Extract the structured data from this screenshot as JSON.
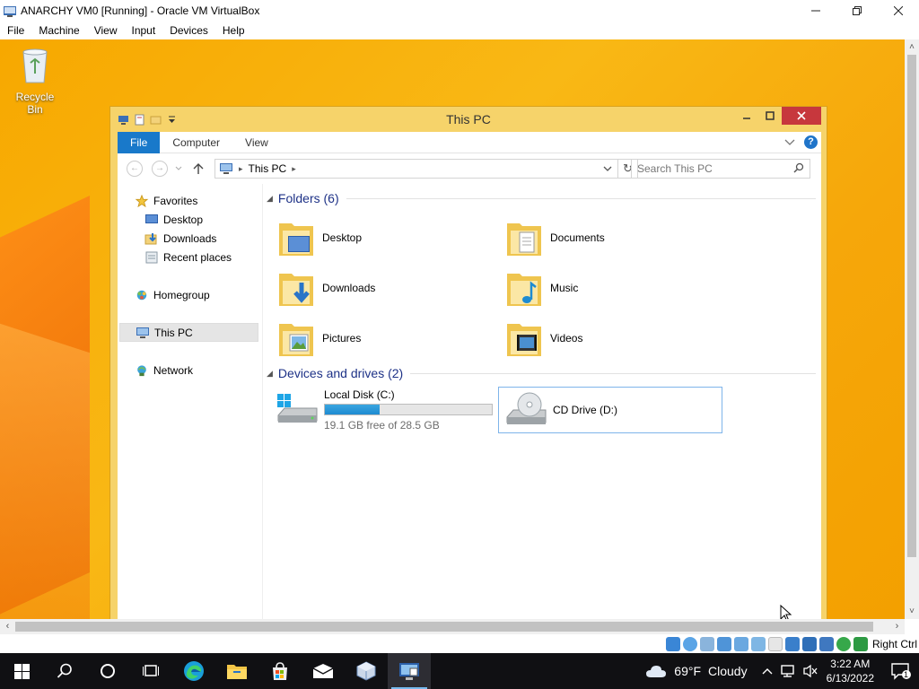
{
  "vbox": {
    "title": "ANARCHY VM0 [Running] - Oracle VM VirtualBox",
    "menu": [
      "File",
      "Machine",
      "View",
      "Input",
      "Devices",
      "Help"
    ],
    "host_key": "Right Ctrl"
  },
  "desktop": {
    "recycle_bin": "Recycle Bin"
  },
  "explorer": {
    "title": "This PC",
    "tabs": {
      "file": "File",
      "computer": "Computer",
      "view": "View"
    },
    "help": "?",
    "address": {
      "location": "This PC"
    },
    "search": {
      "placeholder": "Search This PC"
    },
    "nav": {
      "favorites": "Favorites",
      "desktop": "Desktop",
      "downloads": "Downloads",
      "recent": "Recent places",
      "homegroup": "Homegroup",
      "this_pc": "This PC",
      "network": "Network"
    },
    "folders_header": "Folders (6)",
    "folders": [
      "Desktop",
      "Documents",
      "Downloads",
      "Music",
      "Pictures",
      "Videos"
    ],
    "devices_header": "Devices and drives (2)",
    "drives": {
      "c": {
        "name": "Local Disk (C:)",
        "free_text": "19.1 GB free of 28.5 GB",
        "used_fraction": 0.33
      },
      "d": {
        "name": "CD Drive (D:)"
      }
    }
  },
  "taskbar": {
    "weather": {
      "temp": "69°F",
      "condition": "Cloudy"
    },
    "time": "3:22 AM",
    "date": "6/13/2022",
    "notification_count": "1"
  },
  "colors": {
    "wallpaper": "#f9b815",
    "explorer_frame": "#f6d36a",
    "ribbon_file_tab": "#1979ca",
    "close_button": "#c7373d",
    "group_header": "#1e3287",
    "drive_bar": "#1e8bd1",
    "taskbar": "#101013"
  }
}
